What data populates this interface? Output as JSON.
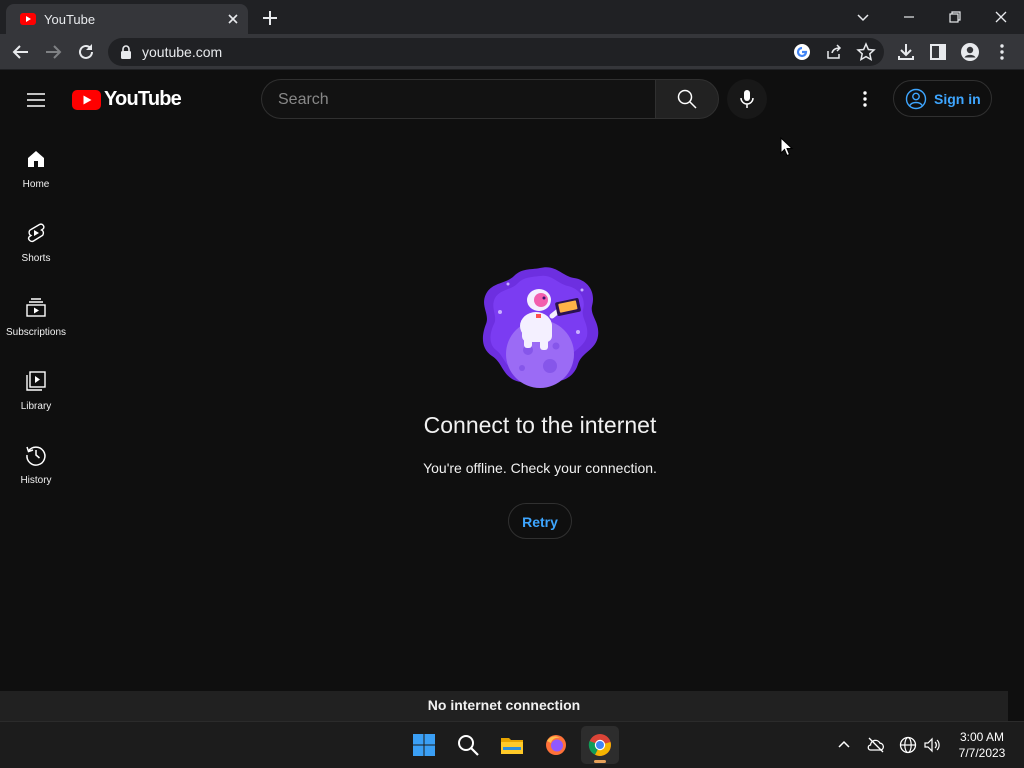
{
  "browser": {
    "tab_title": "YouTube",
    "url": "youtube.com"
  },
  "header": {
    "logo_text": "YouTube",
    "search_placeholder": "Search",
    "signin_label": "Sign in"
  },
  "sidebar": {
    "items": [
      {
        "label": "Home",
        "icon": "home-icon"
      },
      {
        "label": "Shorts",
        "icon": "shorts-icon"
      },
      {
        "label": "Subscriptions",
        "icon": "subscriptions-icon"
      },
      {
        "label": "Library",
        "icon": "library-icon"
      },
      {
        "label": "History",
        "icon": "history-icon"
      }
    ]
  },
  "main": {
    "title": "Connect to the internet",
    "message": "You're offline. Check your connection.",
    "retry_label": "Retry"
  },
  "status_bar": {
    "text": "No internet connection"
  },
  "taskbar": {
    "time": "3:00 AM",
    "date": "7/7/2023",
    "apps": [
      "start-icon",
      "search-icon",
      "file-explorer-icon",
      "firefox-icon",
      "chrome-icon"
    ]
  },
  "colors": {
    "accent_blue": "#3ea6ff",
    "youtube_red": "#ff0000",
    "background": "#0f0f0f"
  }
}
